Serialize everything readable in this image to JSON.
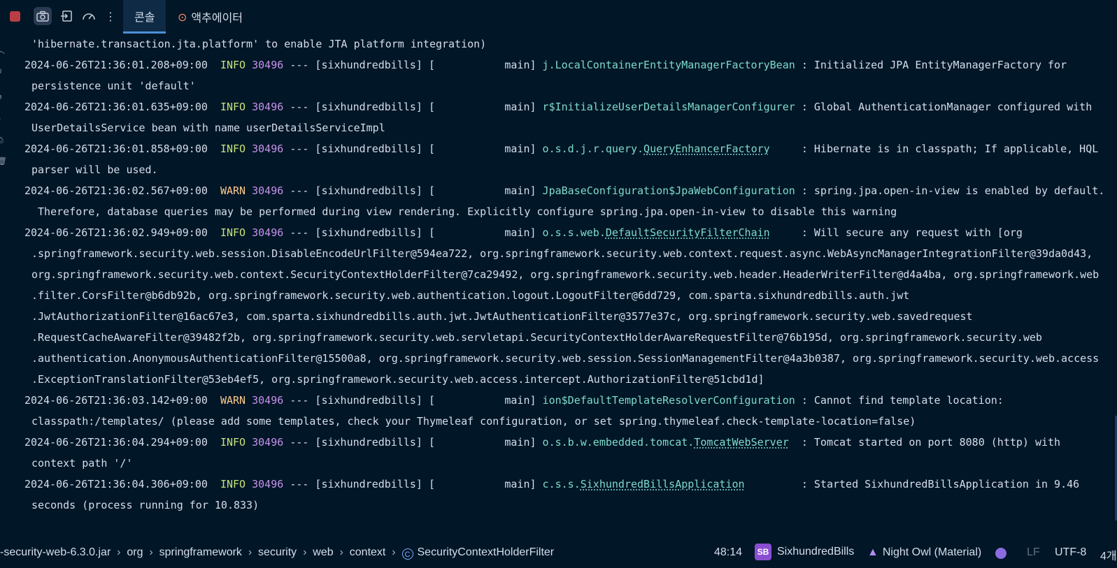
{
  "toolbar": {
    "tabs": [
      {
        "label": "콘솔",
        "active": true
      },
      {
        "label": "액추에이터",
        "active": false,
        "icon": "actuator-icon"
      }
    ],
    "buttons": [
      "stop-icon",
      "camera-icon",
      "exit-icon",
      "dashboard-icon",
      "more-icon"
    ]
  },
  "log": {
    "lines": [
      {
        "cont": "'hibernate.transaction.jta.platform' to enable JTA platform integration)"
      },
      {
        "ts": "2024-06-26T21:36:01.208+09:00",
        "level": "INFO",
        "pid": "30496",
        "thread": "--- [sixhundredbills] [           main]",
        "pkg": "",
        "cls": "j.LocalContainerEntityManagerFactoryBean",
        "pad": " ",
        "msg": ": Initialized JPA EntityManagerFactory for"
      },
      {
        "cont": "persistence unit 'default'"
      },
      {
        "ts": "2024-06-26T21:36:01.635+09:00",
        "level": "INFO",
        "pid": "30496",
        "thread": "--- [sixhundredbills] [           main]",
        "pkg": "",
        "cls": "r$InitializeUserDetailsManagerConfigurer",
        "pad": " ",
        "msg": ": Global AuthenticationManager configured with"
      },
      {
        "cont": "UserDetailsService bean with name userDetailsServiceImpl"
      },
      {
        "ts": "2024-06-26T21:36:01.858+09:00",
        "level": "INFO",
        "pid": "30496",
        "thread": "--- [sixhundredbills] [           main]",
        "pkg": "o.s.d.j.r.query.",
        "cls": "QueryEnhancerFactory",
        "pad": "     ",
        "msg": ": Hibernate is in classpath; If applicable, HQL"
      },
      {
        "cont": "parser will be used."
      },
      {
        "ts": "2024-06-26T21:36:02.567+09:00",
        "level": "WARN",
        "pid": "30496",
        "thread": "--- [sixhundredbills] [           main]",
        "pkg": "",
        "cls": "JpaBaseConfiguration$JpaWebConfiguration",
        "pad": " ",
        "msg": ": spring.jpa.open-in-view is enabled by default."
      },
      {
        "cont": " Therefore, database queries may be performed during view rendering. Explicitly configure spring.jpa.open-in-view to disable this warning"
      },
      {
        "ts": "2024-06-26T21:36:02.949+09:00",
        "level": "INFO",
        "pid": "30496",
        "thread": "--- [sixhundredbills] [           main]",
        "pkg": "o.s.s.web.",
        "cls": "DefaultSecurityFilterChain",
        "pad": "     ",
        "msg": ": Will secure any request with [org"
      },
      {
        "cont": ".springframework.security.web.session.DisableEncodeUrlFilter@594ea722, org.springframework.security.web.context.request.async.WebAsyncManagerIntegrationFilter@39da0d43,"
      },
      {
        "cont": "org.springframework.security.web.context.SecurityContextHolderFilter@7ca29492, org.springframework.security.web.header.HeaderWriterFilter@d4a4ba, org.springframework.web"
      },
      {
        "cont": ".filter.CorsFilter@b6db92b, org.springframework.security.web.authentication.logout.LogoutFilter@6dd729, com.sparta.sixhundredbills.auth.jwt"
      },
      {
        "cont": ".JwtAuthorizationFilter@16ac67e3, com.sparta.sixhundredbills.auth.jwt.JwtAuthenticationFilter@3577e37c, org.springframework.security.web.savedrequest"
      },
      {
        "cont": ".RequestCacheAwareFilter@39482f2b, org.springframework.security.web.servletapi.SecurityContextHolderAwareRequestFilter@76b195d, org.springframework.security.web"
      },
      {
        "cont": ".authentication.AnonymousAuthenticationFilter@15500a8, org.springframework.security.web.session.SessionManagementFilter@4a3b0387, org.springframework.security.web.access"
      },
      {
        "cont": ".ExceptionTranslationFilter@53eb4ef5, org.springframework.security.web.access.intercept.AuthorizationFilter@51cbd1d]"
      },
      {
        "ts": "2024-06-26T21:36:03.142+09:00",
        "level": "WARN",
        "pid": "30496",
        "thread": "--- [sixhundredbills] [           main]",
        "pkg": "",
        "cls": "ion$DefaultTemplateResolverConfiguration",
        "pad": " ",
        "msg": ": Cannot find template location:"
      },
      {
        "cont": "classpath:/templates/ (please add some templates, check your Thymeleaf configuration, or set spring.thymeleaf.check-template-location=false)"
      },
      {
        "ts": "2024-06-26T21:36:04.294+09:00",
        "level": "INFO",
        "pid": "30496",
        "thread": "--- [sixhundredbills] [           main]",
        "pkg": "o.s.b.w.embedded.tomcat.",
        "cls": "TomcatWebServer",
        "pad": "  ",
        "msg": ": Tomcat started on port 8080 (http) with"
      },
      {
        "cont": "context path '/'"
      },
      {
        "ts": "2024-06-26T21:36:04.306+09:00",
        "level": "INFO",
        "pid": "30496",
        "thread": "--- [sixhundredbills] [           main]",
        "pkg": "c.s.s.",
        "cls": "SixhundredBillsApplication",
        "pad": "         ",
        "msg": ": Started SixhundredBillsApplication in 9.46"
      },
      {
        "cont": "seconds (process running for 10.833)"
      }
    ]
  },
  "statusbar": {
    "breadcrumb": [
      "-security-web-6.3.0.jar",
      "org",
      "springframework",
      "security",
      "web",
      "context"
    ],
    "current_class": "SecurityContextHolderFilter",
    "cursor": "48:14",
    "project_badge": "SB",
    "project": "SixhundredBills",
    "theme": "Night Owl (Material)",
    "line_sep": "LF",
    "encoding": "UTF-8",
    "indent": "4개"
  },
  "colors": {
    "background": "#011627",
    "info": "#c5e478",
    "warn": "#ffcb8b",
    "pid": "#c792ea",
    "logger": "#7fdbca"
  }
}
